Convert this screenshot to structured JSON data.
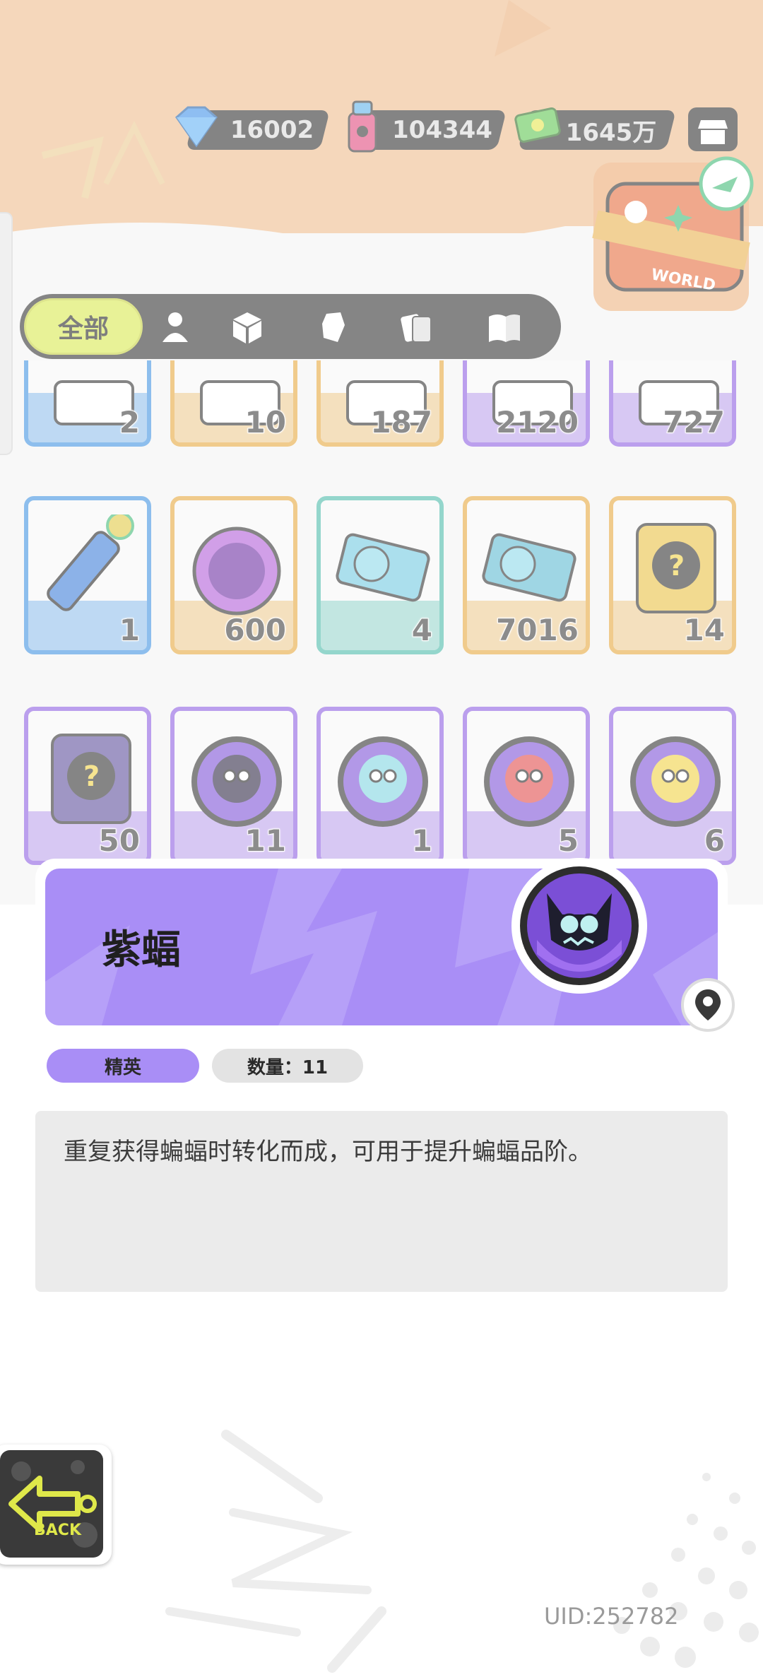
{
  "currency": {
    "gems": "16002",
    "spray": "104344",
    "cash": "1645万"
  },
  "tabs": [
    {
      "label": "全部",
      "icon": "all-tab",
      "active": true
    },
    {
      "label": "",
      "icon": "person-icon"
    },
    {
      "label": "",
      "icon": "box-icon"
    },
    {
      "label": "",
      "icon": "fist-icon"
    },
    {
      "label": "",
      "icon": "cards-icon"
    },
    {
      "label": "",
      "icon": "book-icon"
    }
  ],
  "rows": [
    [
      {
        "count": "2",
        "border": "#3b8fe0"
      },
      {
        "count": "10",
        "border": "#e6a63a"
      },
      {
        "count": "187",
        "border": "#e6a63a"
      },
      {
        "count": "2120",
        "border": "#8a5ae0"
      },
      {
        "count": "727",
        "border": "#8a5ae0"
      }
    ],
    [
      {
        "count": "1",
        "border": "#3b8fe0",
        "icon": "crayon-icon"
      },
      {
        "count": "600",
        "border": "#e6a63a",
        "icon": "cool-sticker-icon"
      },
      {
        "count": "4",
        "border": "#48b8a8",
        "icon": "ticket-icon"
      },
      {
        "count": "7016",
        "border": "#e6a63a",
        "icon": "pet-ticket-icon"
      },
      {
        "count": "14",
        "border": "#e6a63a",
        "icon": "mystery-card-icon"
      }
    ],
    [
      {
        "count": "50",
        "border": "#8a5ae0",
        "icon": "travel-card-icon"
      },
      {
        "count": "11",
        "border": "#8a5ae0",
        "icon": "purple-bat-icon"
      },
      {
        "count": "1",
        "border": "#8a5ae0",
        "icon": "blue-bird-icon"
      },
      {
        "count": "5",
        "border": "#8a5ae0",
        "icon": "red-fish-icon"
      },
      {
        "count": "6",
        "border": "#8a5ae0",
        "icon": "yellow-jelly-icon"
      }
    ]
  ],
  "detail": {
    "title": "紫蝠",
    "rarity": "精英",
    "quantity": "数量：11",
    "description": "重复获得蝙蝠时转化而成，可用于提升蝙蝠品阶。"
  },
  "travel_badge": "WORLD",
  "uid": "UID:252782",
  "back": "BACK",
  "colors": {
    "accent_purple": "#a98ef6",
    "tab_active": "#d8e84c"
  }
}
